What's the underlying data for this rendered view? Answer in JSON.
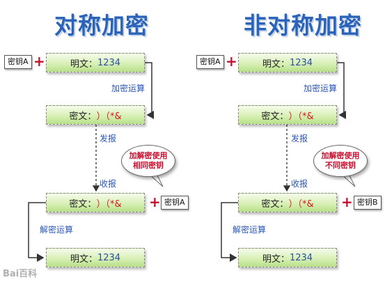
{
  "left": {
    "title": "对称加密",
    "key_top": "密钥A",
    "plain_top": {
      "label": "明文：",
      "value": "1234"
    },
    "encrypt_op": "加密运算",
    "cipher_top": {
      "label": "密文：",
      "value": "）（*&"
    },
    "send": "发报",
    "receive": "收报",
    "bubble": {
      "line1": "加解密使用",
      "line2": "相同密钥"
    },
    "cipher_bottom": {
      "label": "密文：",
      "value": "）（*&"
    },
    "key_bottom": "密钥A",
    "decrypt_op": "解密运算",
    "plain_bottom": {
      "label": "明文：",
      "value": "1234"
    }
  },
  "right": {
    "title": "非对称加密",
    "key_top": "密钥A",
    "plain_top": {
      "label": "明文：",
      "value": "1234"
    },
    "encrypt_op": "加密运算",
    "cipher_top": {
      "label": "密文：",
      "value": "）（*&"
    },
    "send": "发报",
    "receive": "收报",
    "bubble": {
      "line1": "加解密使用",
      "line2": "不同密钥"
    },
    "cipher_bottom": {
      "label": "密文：",
      "value": "）（*&"
    },
    "key_bottom": "密钥B",
    "decrypt_op": "解密运算",
    "plain_bottom": {
      "label": "明文：",
      "value": "1234"
    }
  },
  "plus_sign": "+",
  "watermark": "Bai百科",
  "colors": {
    "title": "#2a63b8",
    "label": "#2a56b8",
    "plus": "#c8102e",
    "bubble_text": "#c8102e",
    "box_fill": "#c6e79a"
  }
}
